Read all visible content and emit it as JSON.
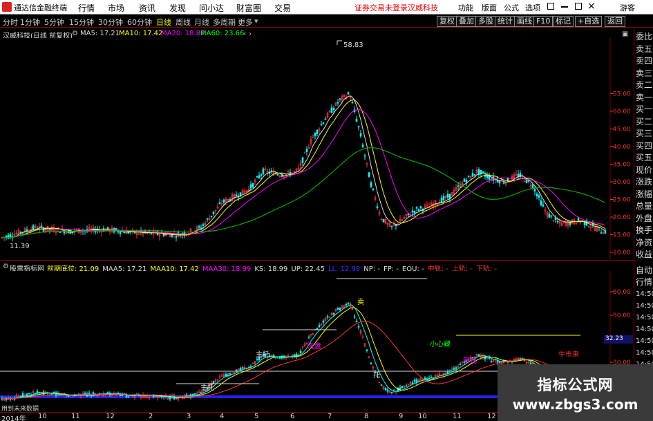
{
  "menubar": {
    "app_title": "通达信金融终端",
    "menus": [
      "行情",
      "市场",
      "资讯",
      "发现",
      "问小达",
      "财富圈",
      "交易"
    ],
    "warning": "证券交易未登录",
    "stock_name": "汉威科技",
    "right": [
      "功能",
      "版面",
      "公式",
      "选项",
      "游客"
    ]
  },
  "periodbar": {
    "periods": [
      "分时",
      "1分钟",
      "5分钟",
      "15分钟",
      "30分钟",
      "60分钟",
      "日线",
      "周线",
      "月线",
      "多周期",
      "更多"
    ],
    "active_index": 6,
    "tools": [
      "复权",
      "叠加",
      "多股",
      "统计",
      "画线",
      "F10",
      "标记",
      "+自选",
      "返回"
    ]
  },
  "main_legend": {
    "title": "汉威科技(日线 前复权)",
    "ma5": "MA5: 17.21",
    "ma10": "MA10: 17.42",
    "ma20": "MA20: 18.87",
    "ma60": "MA60: 23.66"
  },
  "main_axis": [
    "55.00",
    "50.00",
    "45.00",
    "40.00",
    "35.00",
    "30.00",
    "25.00",
    "20.00",
    "15.00",
    "10.00"
  ],
  "peak_label": "58.83",
  "low_label": "11.39",
  "indicator_legend": {
    "title": "股票指标网",
    "items": [
      {
        "text": "前期底位: 21.09",
        "color": "#ff0"
      },
      {
        "text": "MAA5: 17.21",
        "color": "#ddd"
      },
      {
        "text": "MAA10: 17.42",
        "color": "#ff0"
      },
      {
        "text": "MAA30: 18.99",
        "color": "#f0f"
      },
      {
        "text": "KS: 18.99",
        "color": "#ddd"
      },
      {
        "text": "UP: 22.45",
        "color": "#ddd"
      },
      {
        "text": "LL: 12.98",
        "color": "#33f"
      },
      {
        "text": "NP: -",
        "color": "#ddd"
      },
      {
        "text": "FP: -",
        "color": "#ddd"
      },
      {
        "text": "EQU: -",
        "color": "#ddd"
      },
      {
        "text": "中轨: -",
        "color": "#f33"
      },
      {
        "text": "上轨: -",
        "color": "#f33"
      },
      {
        "text": "下轨: -",
        "color": "#f33"
      }
    ]
  },
  "ind_axis": [
    "60.00",
    "50.00",
    "40.00",
    "30.00"
  ],
  "ind_tag": "32.23",
  "ind_annotations": [
    "小心藏",
    "牛市来",
    "主托",
    "洗盘",
    "新托",
    "主托",
    "托",
    "卖"
  ],
  "right_panel": [
    "委比",
    "卖五",
    "卖四",
    "卖三",
    "卖二",
    "卖一",
    "买一",
    "买二",
    "买三",
    "买四",
    "买五",
    "现价",
    "涨跌",
    "涨幅",
    "总量",
    "外盘",
    "换手",
    "净资",
    "收益"
  ],
  "right_panel2": [
    "自动",
    "行情",
    "14:50",
    "14:50",
    "14:50",
    "14:50",
    "14:50",
    "14:50",
    "14:50",
    "14:50",
    "14:50"
  ],
  "status_text": "用到未来数据",
  "dates": [
    "2014年",
    "10",
    "11",
    "12",
    "2",
    "3",
    "4",
    "5",
    "6",
    "7",
    "8",
    "9",
    "10",
    "11",
    "12"
  ],
  "watermark": {
    "line1": "指标公式网",
    "line2": "www.zbgs3.com"
  }
}
